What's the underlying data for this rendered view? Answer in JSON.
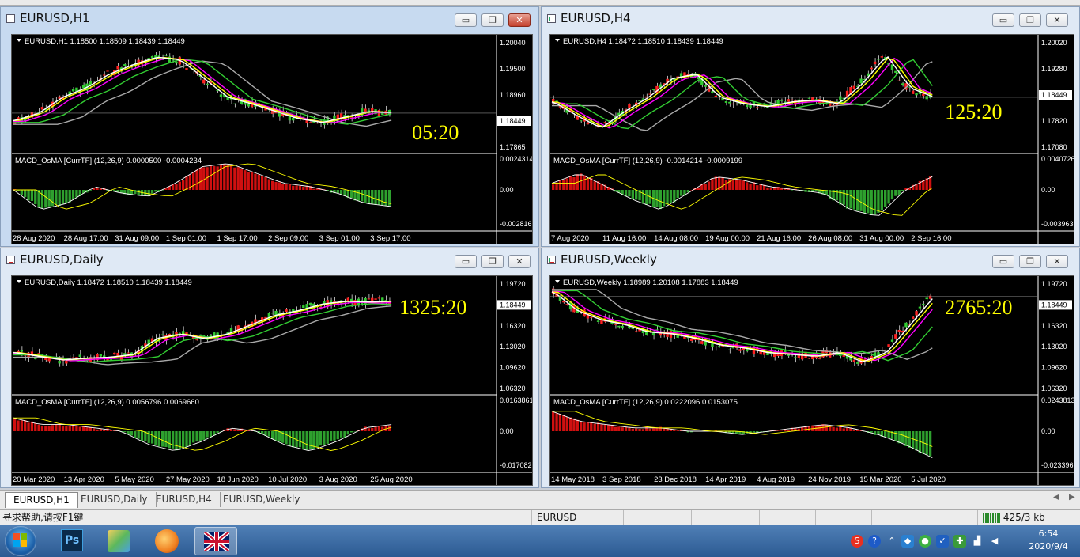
{
  "colors": {
    "accent_yellow": "#ffff00",
    "macd_green": "#2ea02e",
    "macd_red": "#d01010",
    "ma_white": "#ffffff",
    "ma_yellow": "#ffff00",
    "ma_magenta": "#ff00ff",
    "ma_green": "#32cd32",
    "ma_gray": "#a9a9a9"
  },
  "windows": [
    {
      "title": "EURUSD,H1",
      "header": "EURUSD,H1  1.18500 1.18509 1.18439 1.18449",
      "timer": "05:20",
      "prices": [
        "1.20040",
        "1.19500",
        "1.18960",
        "1.18449",
        "1.17865"
      ],
      "macd_label": "MACD_OsMA [CurrTF] (12,26,9) 0.0000500 -0.0004234",
      "macd_levels": [
        "0.0024314",
        "0.00",
        "-0.002816"
      ],
      "dates": [
        "28 Aug 2020",
        "28 Aug 17:00",
        "31 Aug 09:00",
        "1 Sep 01:00",
        "1 Sep 17:00",
        "2 Sep 09:00",
        "3 Sep 01:00",
        "3 Sep 17:00"
      ]
    },
    {
      "title": "EURUSD,H4",
      "header": "EURUSD,H4  1.18472 1.18510 1.18439 1.18449",
      "timer": "125:20",
      "prices": [
        "1.20020",
        "1.19280",
        "1.18449",
        "1.17820",
        "1.17080"
      ],
      "macd_label": "MACD_OsMA [CurrTF] (12,26,9) -0.0014214 -0.0009199",
      "macd_levels": [
        "0.0040726",
        "0.00",
        "-0.003963"
      ],
      "dates": [
        "7 Aug 2020",
        "11 Aug 16:00",
        "14 Aug 08:00",
        "19 Aug 00:00",
        "21 Aug 16:00",
        "26 Aug 08:00",
        "31 Aug 00:00",
        "2 Sep 16:00"
      ]
    },
    {
      "title": "EURUSD,Daily",
      "header": "EURUSD,Daily  1.18472 1.18510 1.18439 1.18449",
      "timer": "1325:20",
      "prices": [
        "1.19720",
        "1.18449",
        "1.16320",
        "1.13020",
        "1.09620",
        "1.06320"
      ],
      "macd_label": "MACD_OsMA [CurrTF] (12,26,9) 0.0056796 0.0069660",
      "macd_levels": [
        "0.0163861",
        "0.00",
        "-0.017082"
      ],
      "dates": [
        "20 Mar 2020",
        "13 Apr 2020",
        "5 May 2020",
        "27 May 2020",
        "18 Jun 2020",
        "10 Jul 2020",
        "3 Aug 2020",
        "25 Aug 2020"
      ]
    },
    {
      "title": "EURUSD,Weekly",
      "header": "EURUSD,Weekly  1.18989 1.20108 1.17883 1.18449",
      "timer": "2765:20",
      "prices": [
        "1.19720",
        "1.18449",
        "1.16320",
        "1.13020",
        "1.09620",
        "1.06320"
      ],
      "macd_label": "MACD_OsMA [CurrTF] (12,26,9) 0.0222096 0.0153075",
      "macd_levels": [
        "0.0243813",
        "0.00",
        "-0.023396"
      ],
      "dates": [
        "14 May 2018",
        "3 Sep 2018",
        "23 Dec 2018",
        "14 Apr 2019",
        "4 Aug 2019",
        "24 Nov 2019",
        "15 Mar 2020",
        "5 Jul 2020"
      ]
    }
  ],
  "tabs": [
    "EURUSD,H1",
    "EURUSD,Daily",
    "EURUSD,H4",
    "EURUSD,Weekly"
  ],
  "status": {
    "help": "寻求帮助,请按F1键",
    "symbol": "EURUSD",
    "traffic": "425/3 kb"
  },
  "taskbar": {
    "time": "6:54",
    "date": "2020/9/4",
    "ps_label": "Ps"
  }
}
